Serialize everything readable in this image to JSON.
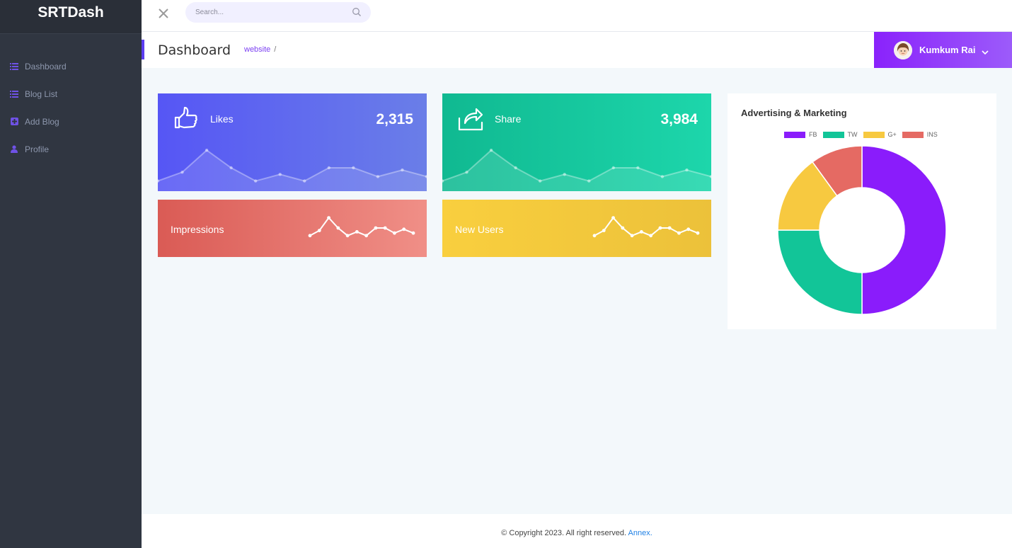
{
  "brand": {
    "name": "SRTDash"
  },
  "sidebar": {
    "items": [
      {
        "label": "Dashboard",
        "icon": "list-icon"
      },
      {
        "label": "Blog List",
        "icon": "list-icon"
      },
      {
        "label": "Add Blog",
        "icon": "plus-square-icon"
      },
      {
        "label": "Profile",
        "icon": "user-icon"
      }
    ],
    "icon_color": "#6f52e6"
  },
  "topbar": {
    "search_placeholder": "Search..."
  },
  "page": {
    "title": "Dashboard",
    "breadcrumb": {
      "link": "website",
      "separator": "/"
    }
  },
  "user": {
    "name": "Kumkum Rai"
  },
  "cards": {
    "likes": {
      "label": "Likes",
      "value": "2,315"
    },
    "share": {
      "label": "Share",
      "value": "3,984"
    },
    "impressions": {
      "label": "Impressions"
    },
    "new_users": {
      "label": "New Users"
    }
  },
  "chart_data": [
    {
      "type": "line",
      "series": [
        {
          "values": [
            2,
            4,
            9,
            5,
            2,
            3.5,
            2,
            5,
            5,
            3,
            4.5,
            3
          ]
        }
      ],
      "ylim": [
        0,
        10
      ],
      "grid": false
    },
    {
      "type": "pie",
      "title": "Advertising & Marketing",
      "labels": [
        "FB",
        "TW",
        "G+",
        "INS"
      ],
      "values": [
        50,
        25,
        15,
        10
      ],
      "colors": [
        "#8a1cfb",
        "#12c598",
        "#f7c940",
        "#e56a63"
      ],
      "legend": "top"
    }
  ],
  "footer": {
    "text": "© Copyright 2023. All right reserved. ",
    "link": "Annex."
  },
  "colors": {
    "sidebar": "#303641",
    "accent": "#8a22fb",
    "background": "#f3f8fb"
  }
}
